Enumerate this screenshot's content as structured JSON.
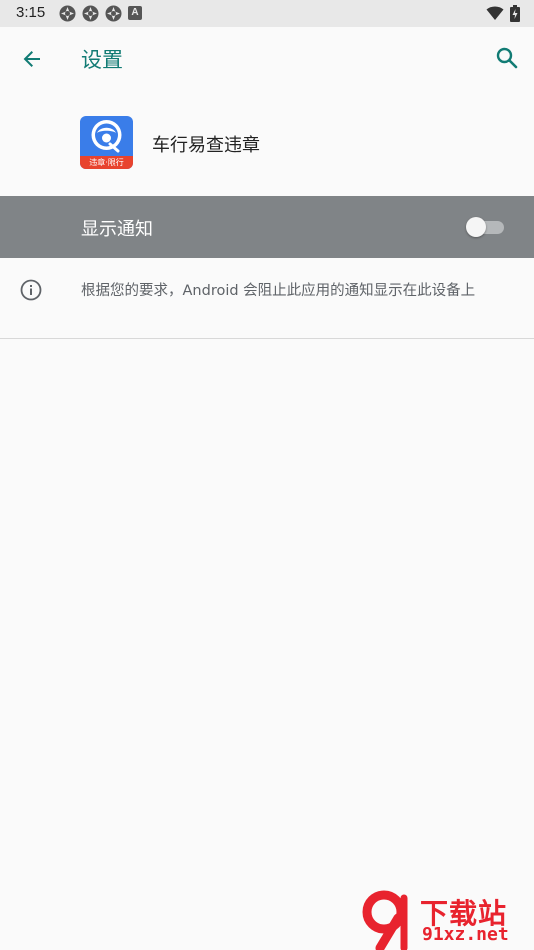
{
  "status_bar": {
    "time": "3:15",
    "left_icons": [
      "notification-app-icon",
      "notification-app-icon",
      "notification-app-icon",
      "a-badge-icon"
    ],
    "a_badge": "A",
    "right_icons": [
      "wifi-icon",
      "battery-icon"
    ]
  },
  "toolbar": {
    "title": "设置",
    "back_icon": "arrow-left-icon",
    "search_icon": "search-icon",
    "accent_color": "#117b74"
  },
  "app": {
    "name": "车行易查违章",
    "icon_caption": "违章·限行"
  },
  "show_notifications": {
    "label": "显示通知",
    "enabled": false,
    "row_color": "#808487"
  },
  "info": {
    "text": "根据您的要求，Android 会阻止此应用的通知显示在此设备上",
    "icon": "info-icon"
  },
  "watermark": {
    "title": "下载站",
    "site": "91xz.net",
    "brand_color": "#e8232e"
  }
}
